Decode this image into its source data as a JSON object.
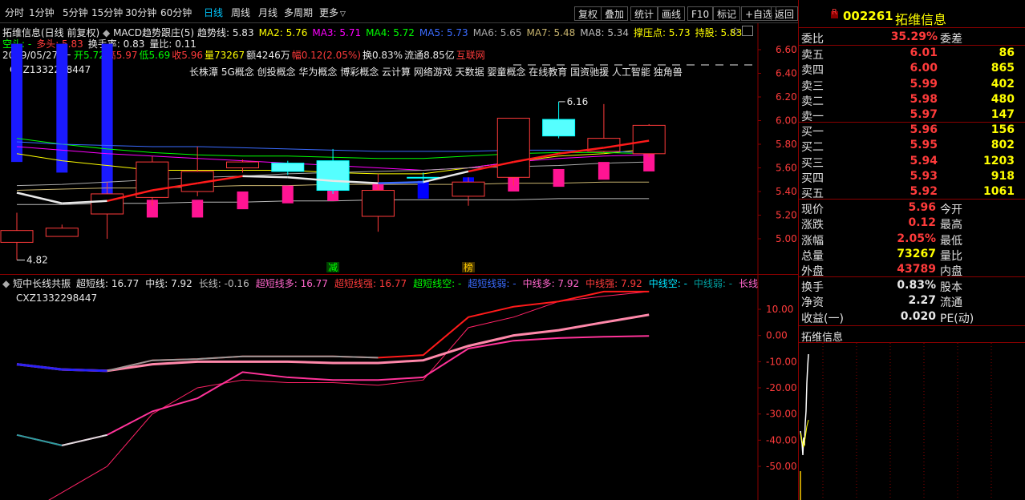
{
  "toolbar": {
    "periods": [
      "分时",
      "1分钟",
      "5分钟",
      "15分钟",
      "30分钟",
      "60分钟",
      "日线",
      "周线",
      "月线",
      "多周期",
      "更多"
    ],
    "active_period": "日线",
    "buttons": [
      "复权",
      "叠加",
      "统计",
      "画线",
      "F10",
      "标记",
      "+自选",
      "返回"
    ]
  },
  "main_chart": {
    "title": "拓维信息(日线 前复权)",
    "indicator_name": "MACD趋势跟庄(5)",
    "indicator_values": [
      {
        "label": "趋势线: 5.83",
        "color": "#e8e8e8"
      },
      {
        "label": "MA2: 5.76",
        "color": "#ffff00"
      },
      {
        "label": "MA3: 5.71",
        "color": "#ff00ff"
      },
      {
        "label": "MA4: 5.72",
        "color": "#00ff00"
      },
      {
        "label": "MA5: 5.73",
        "color": "#3a6bff"
      },
      {
        "label": "MA6: 5.65",
        "color": "#aaaaaa"
      },
      {
        "label": "MA7: 5.48",
        "color": "#c8b46e"
      },
      {
        "label": "MA8: 5.34",
        "color": "#bbbbbb"
      },
      {
        "label": "撑压点: 5.73",
        "color": "#ffff00"
      },
      {
        "label": "持股: 5.83",
        "color": "#ffff00"
      }
    ],
    "line2": [
      {
        "label": "空头: -",
        "color": "#00ff00"
      },
      {
        "label": "多头: 5.83",
        "color": "#ff3b3b"
      },
      {
        "label": "换手率: 0.83",
        "color": "#e8e8e8"
      },
      {
        "label": "量比: 0.11",
        "color": "#e8e8e8"
      }
    ],
    "info_date": "2019/05/27/一",
    "info_items": [
      {
        "label": "开5.72",
        "color": "#00ff00"
      },
      {
        "label": "高5.97",
        "color": "#ff3b3b"
      },
      {
        "label": "低5.69",
        "color": "#00ff00"
      },
      {
        "label": "收5.96",
        "color": "#ff3b3b"
      },
      {
        "label": "量73267",
        "color": "#ffff00"
      },
      {
        "label": "额4246万",
        "color": "#e8e8e8"
      },
      {
        "label": "幅0.12(2.05%)",
        "color": "#ff3b3b"
      },
      {
        "label": "换0.83%",
        "color": "#e8e8e8"
      },
      {
        "label": "流通8.85亿",
        "color": "#e8e8e8"
      },
      {
        "label": "互联网",
        "color": "#ff3b3b"
      }
    ],
    "code_label": "CXZ1332298447",
    "concepts": "长株潭 5G概念 创投概念 华为概念 博彩概念 云计算 网络游戏 天数据 婴童概念 在线教育 国资驰援 人工智能 独角兽",
    "high_mark": "6.16",
    "low_mark": "4.82",
    "marker_reduce": "减",
    "marker_buy": "榜",
    "y_ticks": [
      "6.60",
      "6.40",
      "6.20",
      "6.00",
      "5.80",
      "5.60",
      "5.40",
      "5.20",
      "5.00"
    ]
  },
  "sub_chart": {
    "title": "短中长线共振",
    "values": [
      {
        "label": "超短线: 16.77",
        "color": "#e8e8e8"
      },
      {
        "label": "中线: 7.92",
        "color": "#e8e8e8"
      },
      {
        "label": "长线: -0.16",
        "color": "#bbbbbb"
      },
      {
        "label": "超短线多: 16.77",
        "color": "#ff66cc"
      },
      {
        "label": "超短线强: 16.77",
        "color": "#ff3b3b"
      },
      {
        "label": "超短线空: -",
        "color": "#00ff00"
      },
      {
        "label": "超短线弱: -",
        "color": "#3a6bff"
      },
      {
        "label": "中线多: 7.92",
        "color": "#ff66cc"
      },
      {
        "label": "中线强: 7.92",
        "color": "#ff3b3b"
      },
      {
        "label": "中线空: -",
        "color": "#00e5ff"
      },
      {
        "label": "中线弱: -",
        "color": "#00a0a0"
      },
      {
        "label": "长线多: -0.16",
        "color": "#ff66cc"
      },
      {
        "label": "长线",
        "color": "#ff00ff"
      }
    ],
    "code_label": "CXZ1332298447",
    "y_ticks": [
      "10.00",
      "0.00",
      "-10.00",
      "-20.00",
      "-30.00",
      "-40.00",
      "-50.00"
    ]
  },
  "quote": {
    "badge": "R",
    "code": "002261",
    "name": "拓维信息",
    "weibi_label": "委比",
    "weibi_value": "35.29%",
    "weicha_label": "委差",
    "asks": [
      {
        "n": "卖五",
        "p": "6.01",
        "v": "86"
      },
      {
        "n": "卖四",
        "p": "6.00",
        "v": "865"
      },
      {
        "n": "卖三",
        "p": "5.99",
        "v": "402"
      },
      {
        "n": "卖二",
        "p": "5.98",
        "v": "480"
      },
      {
        "n": "卖一",
        "p": "5.97",
        "v": "147"
      }
    ],
    "bids": [
      {
        "n": "买一",
        "p": "5.96",
        "v": "156"
      },
      {
        "n": "买二",
        "p": "5.95",
        "v": "802"
      },
      {
        "n": "买三",
        "p": "5.94",
        "v": "1203"
      },
      {
        "n": "买四",
        "p": "5.93",
        "v": "918"
      },
      {
        "n": "买五",
        "p": "5.92",
        "v": "1061"
      }
    ],
    "stats1": [
      {
        "n": "现价",
        "v": "5.96",
        "n2": "今开",
        "color": "#ff3b3b"
      },
      {
        "n": "涨跌",
        "v": "0.12",
        "n2": "最高",
        "color": "#ff3b3b"
      },
      {
        "n": "涨幅",
        "v": "2.05%",
        "n2": "最低",
        "color": "#ff3b3b"
      },
      {
        "n": "总量",
        "v": "73267",
        "n2": "量比",
        "color": "#ffff00"
      },
      {
        "n": "外盘",
        "v": "43789",
        "n2": "内盘",
        "color": "#ff3b3b"
      }
    ],
    "stats2": [
      {
        "n": "换手",
        "v": "0.83%",
        "n2": "股本",
        "color": "#e8e8e8"
      },
      {
        "n": "净资",
        "v": "2.27",
        "n2": "流通",
        "color": "#e8e8e8"
      },
      {
        "n": "收益(一)",
        "v": "0.020",
        "n2": "PE(动)",
        "color": "#e8e8e8"
      }
    ],
    "mini_title": "拓维信息"
  },
  "chart_data": {
    "type": "candlestick",
    "candles": [
      {
        "o": 4.97,
        "c": 5.07,
        "h": 5.22,
        "l": 4.82,
        "up": true
      },
      {
        "o": 5.02,
        "c": 5.09,
        "h": 5.12,
        "l": 5.02,
        "up": true
      },
      {
        "o": 5.21,
        "c": 5.38,
        "h": 5.48,
        "l": 5.0,
        "up": true
      },
      {
        "o": 5.35,
        "c": 5.65,
        "h": 5.7,
        "l": 5.28,
        "up": true
      },
      {
        "o": 5.4,
        "c": 5.57,
        "h": 5.78,
        "l": 5.36,
        "up": true
      },
      {
        "o": 5.6,
        "c": 5.65,
        "h": 5.67,
        "l": 5.56,
        "up": true
      },
      {
        "o": 5.64,
        "c": 5.57,
        "h": 5.66,
        "l": 5.54,
        "up": false
      },
      {
        "o": 5.66,
        "c": 5.41,
        "h": 5.76,
        "l": 5.38,
        "up": false
      },
      {
        "o": 5.41,
        "c": 5.19,
        "h": 5.55,
        "l": 5.06,
        "up": true
      },
      {
        "o": 5.52,
        "c": 5.52,
        "h": 5.56,
        "l": 5.47,
        "up": false
      },
      {
        "o": 5.36,
        "c": 5.48,
        "h": 5.52,
        "l": 5.28,
        "up": true
      },
      {
        "o": 5.52,
        "c": 6.02,
        "h": 6.02,
        "l": 5.45,
        "up": true
      },
      {
        "o": 6.01,
        "c": 5.87,
        "h": 6.16,
        "l": 5.85,
        "up": false
      },
      {
        "o": 5.74,
        "c": 5.85,
        "h": 6.14,
        "l": 5.73,
        "up": true
      },
      {
        "o": 5.72,
        "c": 5.96,
        "h": 5.97,
        "l": 5.69,
        "up": true
      }
    ],
    "macd_bars": [
      5.65,
      5.65,
      5.35,
      5.33,
      5.33,
      5.4,
      5.45,
      5.47,
      5.47,
      5.49,
      5.52,
      5.55,
      5.59,
      5.65,
      5.72
    ],
    "macd_bar_colors": [
      "#2b2bff",
      "#2b2bff",
      "#2b2bff",
      "#ff1493",
      "#ff1493",
      "#ff1493",
      "#ff1493",
      "#ff1493",
      "#ff1493",
      "#0000ff",
      "#0000ff",
      "#ff1493",
      "#ff1493",
      "#ff1493",
      "#ff1493"
    ],
    "ma_lines": [
      {
        "color": "#ffff00",
        "values": [
          5.72,
          5.66,
          5.62,
          5.58,
          5.58,
          5.58,
          5.58,
          5.56,
          5.55,
          5.55,
          5.6,
          5.65,
          5.7,
          5.72,
          5.76
        ]
      },
      {
        "color": "#ff00ff",
        "values": [
          5.78,
          5.75,
          5.72,
          5.7,
          5.68,
          5.66,
          5.64,
          5.62,
          5.6,
          5.58,
          5.6,
          5.65,
          5.68,
          5.7,
          5.71
        ]
      },
      {
        "color": "#00ff00",
        "values": [
          5.85,
          5.8,
          5.76,
          5.73,
          5.71,
          5.7,
          5.7,
          5.69,
          5.68,
          5.68,
          5.7,
          5.72,
          5.73,
          5.73,
          5.72
        ]
      },
      {
        "color": "#3a6bff",
        "values": [
          5.82,
          5.8,
          5.79,
          5.78,
          5.78,
          5.77,
          5.76,
          5.75,
          5.74,
          5.74,
          5.74,
          5.75,
          5.75,
          5.74,
          5.73
        ]
      },
      {
        "color": "#aaaaaa",
        "values": [
          5.45,
          5.46,
          5.48,
          5.5,
          5.52,
          5.53,
          5.55,
          5.56,
          5.57,
          5.58,
          5.6,
          5.61,
          5.62,
          5.64,
          5.65
        ]
      },
      {
        "color": "#c8b46e",
        "values": [
          5.41,
          5.42,
          5.43,
          5.43,
          5.44,
          5.45,
          5.45,
          5.46,
          5.46,
          5.46,
          5.46,
          5.47,
          5.47,
          5.48,
          5.48
        ]
      },
      {
        "color": "#bbbbbb",
        "values": [
          5.29,
          5.29,
          5.3,
          5.3,
          5.31,
          5.31,
          5.32,
          5.32,
          5.33,
          5.33,
          5.33,
          5.33,
          5.34,
          5.34,
          5.34
        ]
      }
    ],
    "trend_line": [
      {
        "x": 0,
        "y": 5.39,
        "color": "#00ff00"
      },
      {
        "x": 1,
        "y": 5.3,
        "color": "#e8e8e8"
      },
      {
        "x": 2,
        "y": 5.32,
        "color": "#e8e8e8"
      },
      {
        "x": 3,
        "y": 5.41,
        "color": "#ff1a1a"
      },
      {
        "x": 4,
        "y": 5.47,
        "color": "#ff1a1a"
      },
      {
        "x": 5,
        "y": 5.53,
        "color": "#ff1a1a"
      },
      {
        "x": 6,
        "y": 5.52,
        "color": "#e8e8e8"
      },
      {
        "x": 7,
        "y": 5.49,
        "color": "#e8e8e8"
      },
      {
        "x": 8,
        "y": 5.47,
        "color": "#e8e8e8"
      },
      {
        "x": 9,
        "y": 5.48,
        "color": "#3a6bff"
      },
      {
        "x": 10,
        "y": 5.57,
        "color": "#e8e8e8"
      },
      {
        "x": 11,
        "y": 5.65,
        "color": "#ff1a1a"
      },
      {
        "x": 12,
        "y": 5.72,
        "color": "#ff1a1a"
      },
      {
        "x": 13,
        "y": 5.77,
        "color": "#ff1a1a"
      },
      {
        "x": 14,
        "y": 5.83,
        "color": "#ff1a1a"
      }
    ],
    "sub_lines": {
      "short": [
        -11,
        -13,
        -13.5,
        -9.5,
        -9,
        -8,
        -8,
        -8,
        -8.5,
        -7.5,
        7,
        11,
        13,
        16.77,
        16.77
      ],
      "mid": [
        -11,
        -13,
        -13.5,
        -11,
        -10,
        -10,
        -10,
        -10.5,
        -10.5,
        -9.5,
        -4,
        0,
        2,
        5,
        7.92
      ],
      "long": [
        -38,
        -42,
        -38,
        -29,
        -24,
        -14,
        -16,
        -17,
        -17,
        -16,
        -5,
        -2,
        -1,
        -0.5,
        -0.16
      ],
      "thin": [
        -70,
        -60,
        -50,
        -30,
        -20,
        -17,
        -18,
        -18,
        -19,
        -17,
        3,
        7,
        13,
        15,
        16.77
      ]
    }
  }
}
